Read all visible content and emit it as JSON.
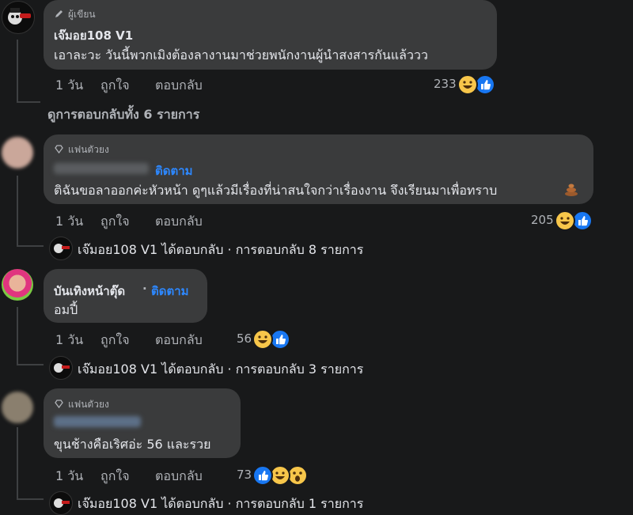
{
  "comments": [
    {
      "badge": "ผู้เขียน",
      "name": "เจ๊มอย108 V1",
      "text": "เอาละวะ วันนี้พวกเมิงต้องลางานมาช่วยพนักงานผู้นำสงสารกันแล้ววว",
      "time": "1 วัน",
      "like": "ถูกใจ",
      "reply": "ตอบกลับ",
      "reactions": "233",
      "replies_link": "ดูการตอบกลับทั้ง 6 รายการ"
    },
    {
      "badge": "แฟนตัวยง",
      "follow": "ติดตาม",
      "text": "ติฉันขอลาออกค่ะหัวหน้า ดูๆแล้วมีเรื่องที่น่าสนใจกว่าเรื่องงาน จึงเรียนมาเพื่อทราบ",
      "time": "1 วัน",
      "like": "ถูกใจ",
      "reply": "ตอบกลับ",
      "reactions": "205",
      "reply_summary": "เจ๊มอย108 V1 ได้ตอบกลับ · การตอบกลับ 8 รายการ"
    },
    {
      "name": "บันเทิงหน้าตุ๊ด",
      "dot": "·",
      "follow": "ติดตาม",
      "text": "อมปี้",
      "time": "1 วัน",
      "like": "ถูกใจ",
      "reply": "ตอบกลับ",
      "reactions": "56",
      "reply_summary": "เจ๊มอย108 V1 ได้ตอบกลับ · การตอบกลับ 3 รายการ"
    },
    {
      "badge": "แฟนตัวยง",
      "text": "ขุนช้างคือเริศอ่ะ 56 และรวย",
      "time": "1 วัน",
      "like": "ถูกใจ",
      "reply": "ตอบกลับ",
      "reactions": "73",
      "reply_summary": "เจ๊มอย108 V1 ได้ตอบกลับ · การตอบกลับ 1 รายการ"
    }
  ],
  "icons": {
    "author_badge": "pencil-icon",
    "fan_badge": "diamond-icon",
    "like_reaction": "like-reaction-icon",
    "haha_reaction": "haha-reaction-icon",
    "wow_reaction": "wow-reaction-icon",
    "poop_emoji": "poop-emoji-icon"
  }
}
